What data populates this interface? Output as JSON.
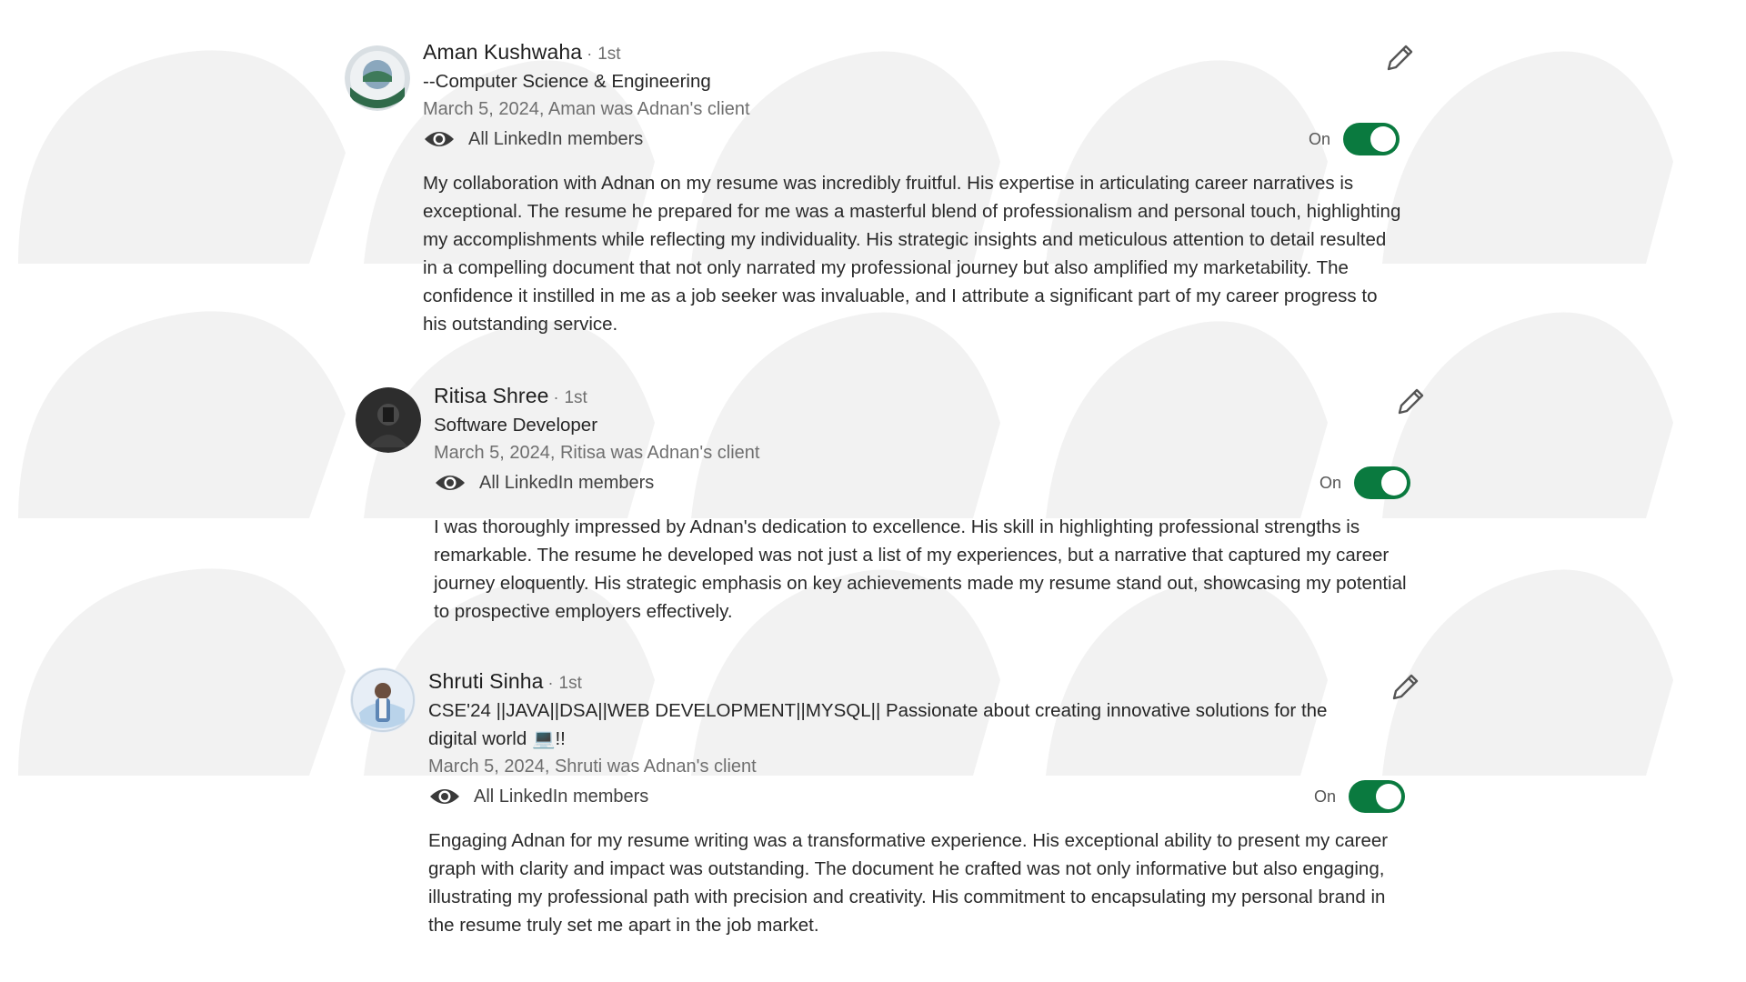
{
  "recommendations": [
    {
      "name": "Aman Kushwaha",
      "separator": "·",
      "degree": "1st",
      "headline": "--Computer Science & Engineering",
      "meta": "March 5, 2024, Aman was Adnan's client",
      "visibility": "All LinkedIn members",
      "toggle_label": "On",
      "text": "My collaboration with Adnan on my resume was incredibly fruitful. His expertise in articulating career narratives is exceptional. The resume he prepared for me was a masterful blend of professionalism and personal touch, highlighting my accomplishments while reflecting my individuality. His strategic insights and meticulous attention to detail resulted in a compelling document that not only narrated my professional journey but also amplified my marketability. The confidence it instilled in me as a job seeker was invaluable, and I attribute a significant part of my career progress to his outstanding service."
    },
    {
      "name": "Ritisa Shree",
      "separator": "·",
      "degree": "1st",
      "headline": "Software Developer",
      "meta": "March 5, 2024, Ritisa was Adnan's client",
      "visibility": "All LinkedIn members",
      "toggle_label": "On",
      "text": "I was thoroughly impressed by Adnan's dedication to excellence. His skill in highlighting professional strengths is remarkable. The resume he developed was not just a list of my experiences, but a narrative that captured my career journey eloquently. His strategic emphasis on key achievements made my resume stand out, showcasing my potential to prospective employers effectively."
    },
    {
      "name": "Shruti Sinha",
      "separator": "·",
      "degree": "1st",
      "headline": "CSE'24 ||JAVA||DSA||WEB DEVELOPMENT||MYSQL|| Passionate about creating innovative solutions for the digital world 💻!!",
      "meta": "March 5, 2024, Shruti was Adnan's client",
      "visibility": "All LinkedIn members",
      "toggle_label": "On",
      "text": "Engaging Adnan for my resume writing was a transformative experience. His exceptional ability to present my career graph with clarity and impact was outstanding. The document he crafted was not only informative but also engaging, illustrating my professional path with precision and creativity. His commitment to encapsulating my personal brand in the resume truly set me apart in the job market."
    }
  ],
  "colors": {
    "toggle_on": "#0a7a3f",
    "text": "#1f1f1f",
    "muted": "#6f6f6f",
    "watermark": "#f3f3f3"
  },
  "icons": {
    "edit": "pencil-icon",
    "visibility": "eye-icon"
  }
}
